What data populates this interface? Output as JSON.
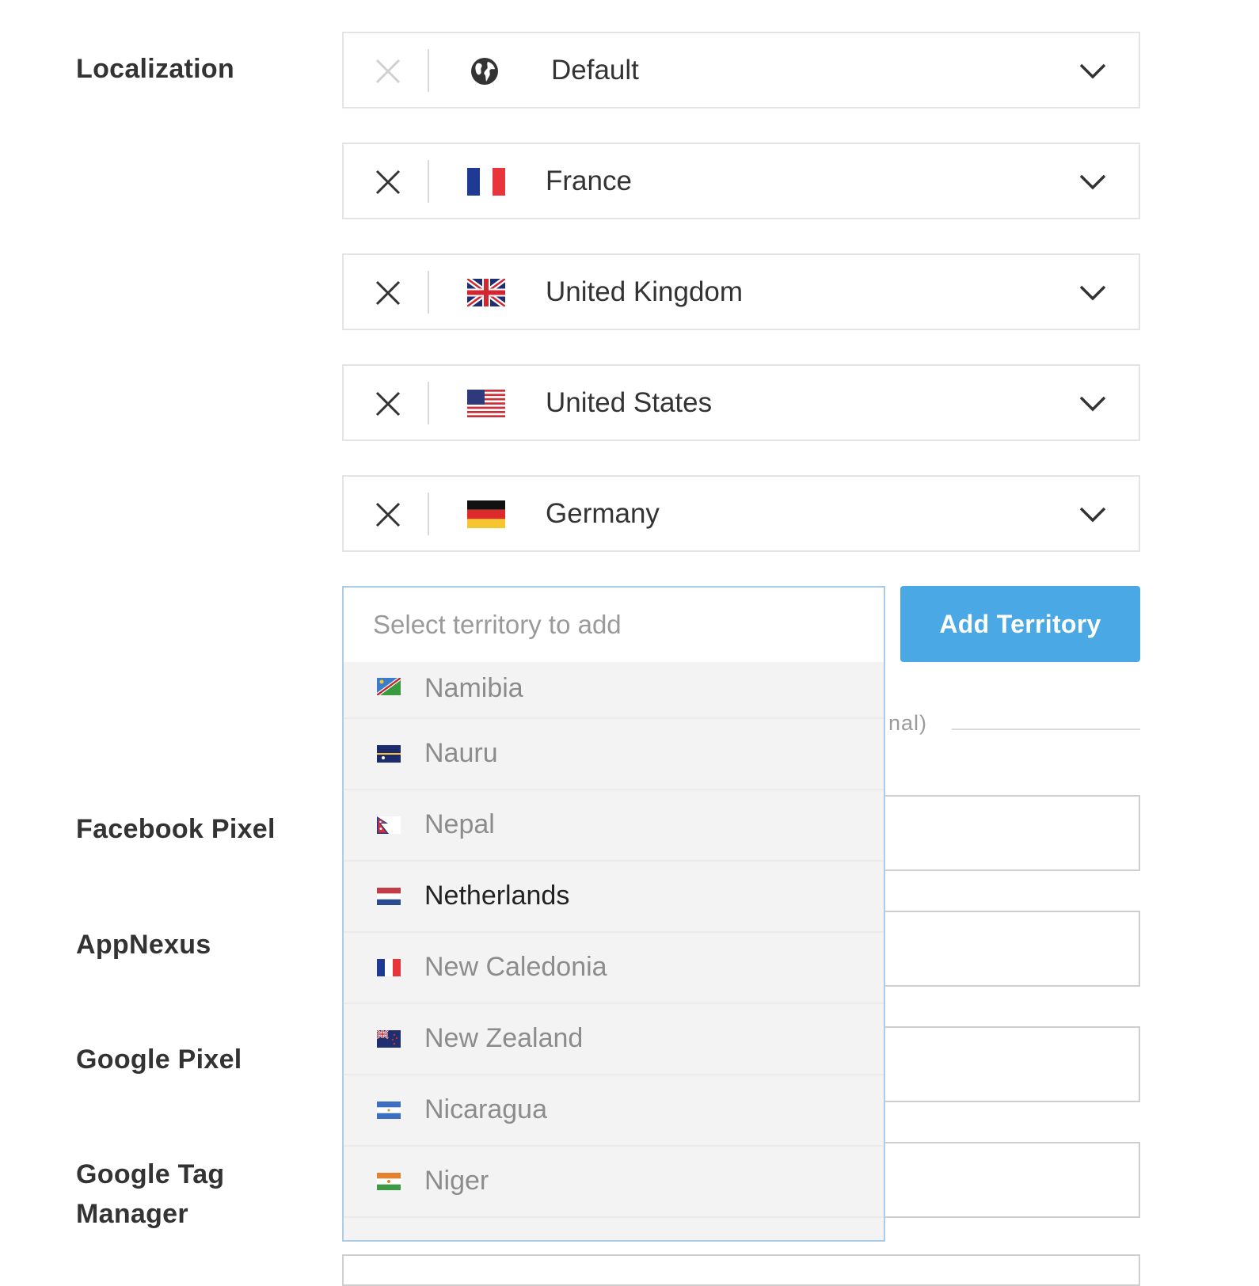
{
  "labels": {
    "localization": "Localization",
    "facebook_pixel": "Facebook Pixel",
    "appnexus": "AppNexus",
    "google_pixel": "Google Pixel",
    "google_tag_manager": "Google Tag Manager"
  },
  "localization_rows": [
    {
      "name": "Default",
      "icon": "globe-icon",
      "remove_enabled": false
    },
    {
      "name": "France",
      "icon": "france-flag-icon",
      "remove_enabled": true
    },
    {
      "name": "United Kingdom",
      "icon": "uk-flag-icon",
      "remove_enabled": true
    },
    {
      "name": "United States",
      "icon": "us-flag-icon",
      "remove_enabled": true
    },
    {
      "name": "Germany",
      "icon": "germany-flag-icon",
      "remove_enabled": true
    }
  ],
  "territory_select": {
    "placeholder": "Select territory to add",
    "options": [
      {
        "name": "Namibia",
        "icon": "namibia-flag-icon"
      },
      {
        "name": "Nauru",
        "icon": "nauru-flag-icon"
      },
      {
        "name": "Nepal",
        "icon": "nepal-flag-icon"
      },
      {
        "name": "Netherlands",
        "icon": "netherlands-flag-icon",
        "highlighted": true
      },
      {
        "name": "New Caledonia",
        "icon": "new-caledonia-flag-icon"
      },
      {
        "name": "New Zealand",
        "icon": "new-zealand-flag-icon"
      },
      {
        "name": "Nicaragua",
        "icon": "nicaragua-flag-icon"
      },
      {
        "name": "Niger",
        "icon": "niger-flag-icon"
      }
    ]
  },
  "add_territory_label": "Add Territory",
  "optional_fragment": "nal)",
  "colors": {
    "accent": "#4aa8e4",
    "text": "#333333",
    "muted": "#8c8c8c",
    "border": "#e4e4e4",
    "dropdown_border": "#a9cde6"
  }
}
